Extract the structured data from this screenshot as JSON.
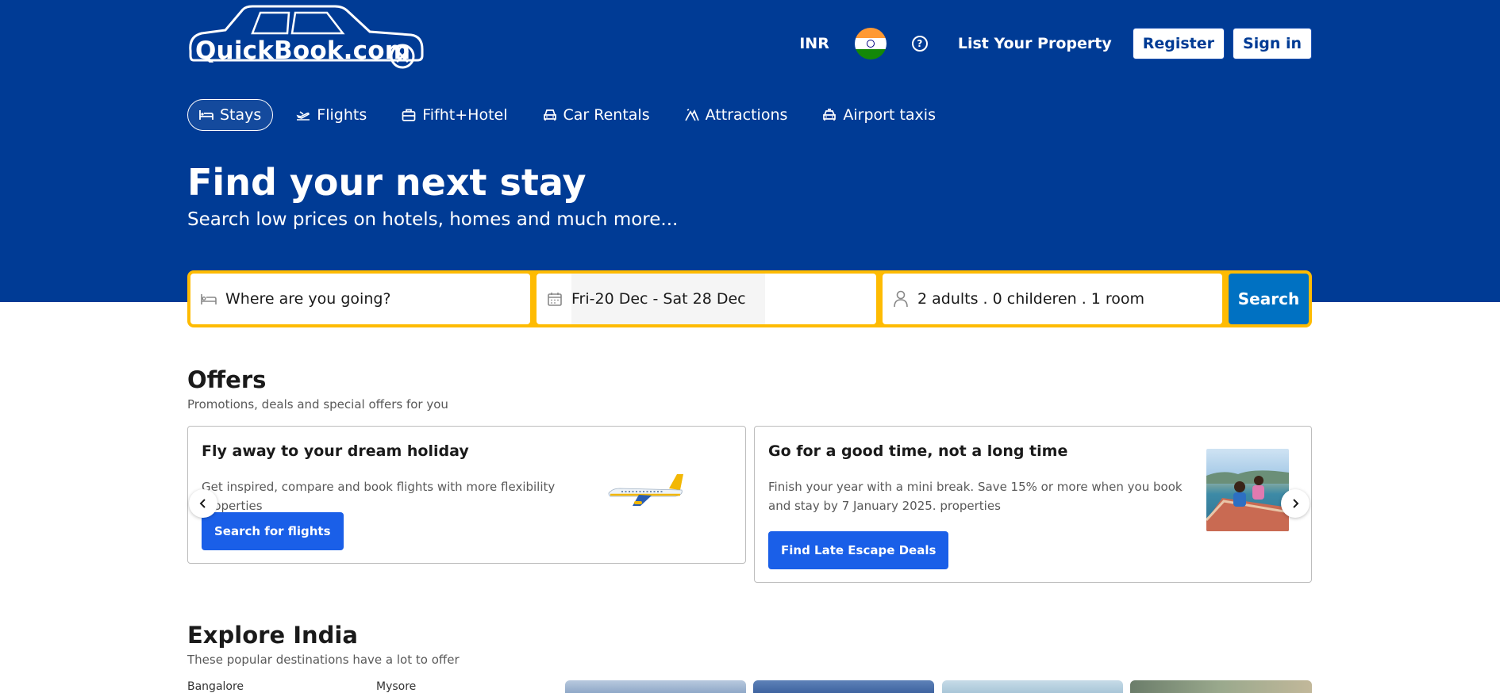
{
  "header": {
    "logo_text": "QuickBook.com",
    "currency": "INR",
    "flag": "india-flag-icon",
    "help_icon": "question-circle-icon",
    "list_property": "List Your Property",
    "register": "Register",
    "sign_in": "Sign in"
  },
  "tabs": [
    {
      "label": "Stays",
      "icon": "bed-icon",
      "active": true
    },
    {
      "label": "Flights",
      "icon": "plane-icon",
      "active": false
    },
    {
      "label": "Fifht+Hotel",
      "icon": "suitcase-icon",
      "active": false
    },
    {
      "label": "Car Rentals",
      "icon": "car-icon",
      "active": false
    },
    {
      "label": "Attractions",
      "icon": "attractions-icon",
      "active": false
    },
    {
      "label": "Airport taxis",
      "icon": "taxi-icon",
      "active": false
    }
  ],
  "hero": {
    "title": "Find your next stay",
    "subtitle": "Search low prices on hotels, homes and much more..."
  },
  "search": {
    "destination_placeholder": "Where are you going?",
    "dates": "Fri-20 Dec - Sat 28 Dec",
    "guests": "2 adults . 0 childeren . 1 room",
    "button": "Search"
  },
  "offers": {
    "title": "Offers",
    "subtitle": "Promotions, deals and special offers for you",
    "cards": [
      {
        "title": "Fly away to your dream holiday",
        "text": "Get inspired, compare and book flights with more flexibility properties",
        "button": "Search for flights",
        "image": "airplane-illustration"
      },
      {
        "title": "Go for a good time, not a long time",
        "text": "Finish your year with a mini break. Save 15% or more when you book and stay by 7 January 2025. properties",
        "button": "Find Late Escape Deals",
        "image": "family-boat-photo"
      }
    ]
  },
  "explore": {
    "title": "Explore India",
    "subtitle": "These popular destinations have a lot to offer",
    "destinations": [
      "Bangalore",
      "Mysore"
    ]
  },
  "colors": {
    "brand_blue": "#003b95",
    "search_yellow": "#febb02",
    "search_button": "#0071c2",
    "cta_blue": "#1a5fe8"
  }
}
